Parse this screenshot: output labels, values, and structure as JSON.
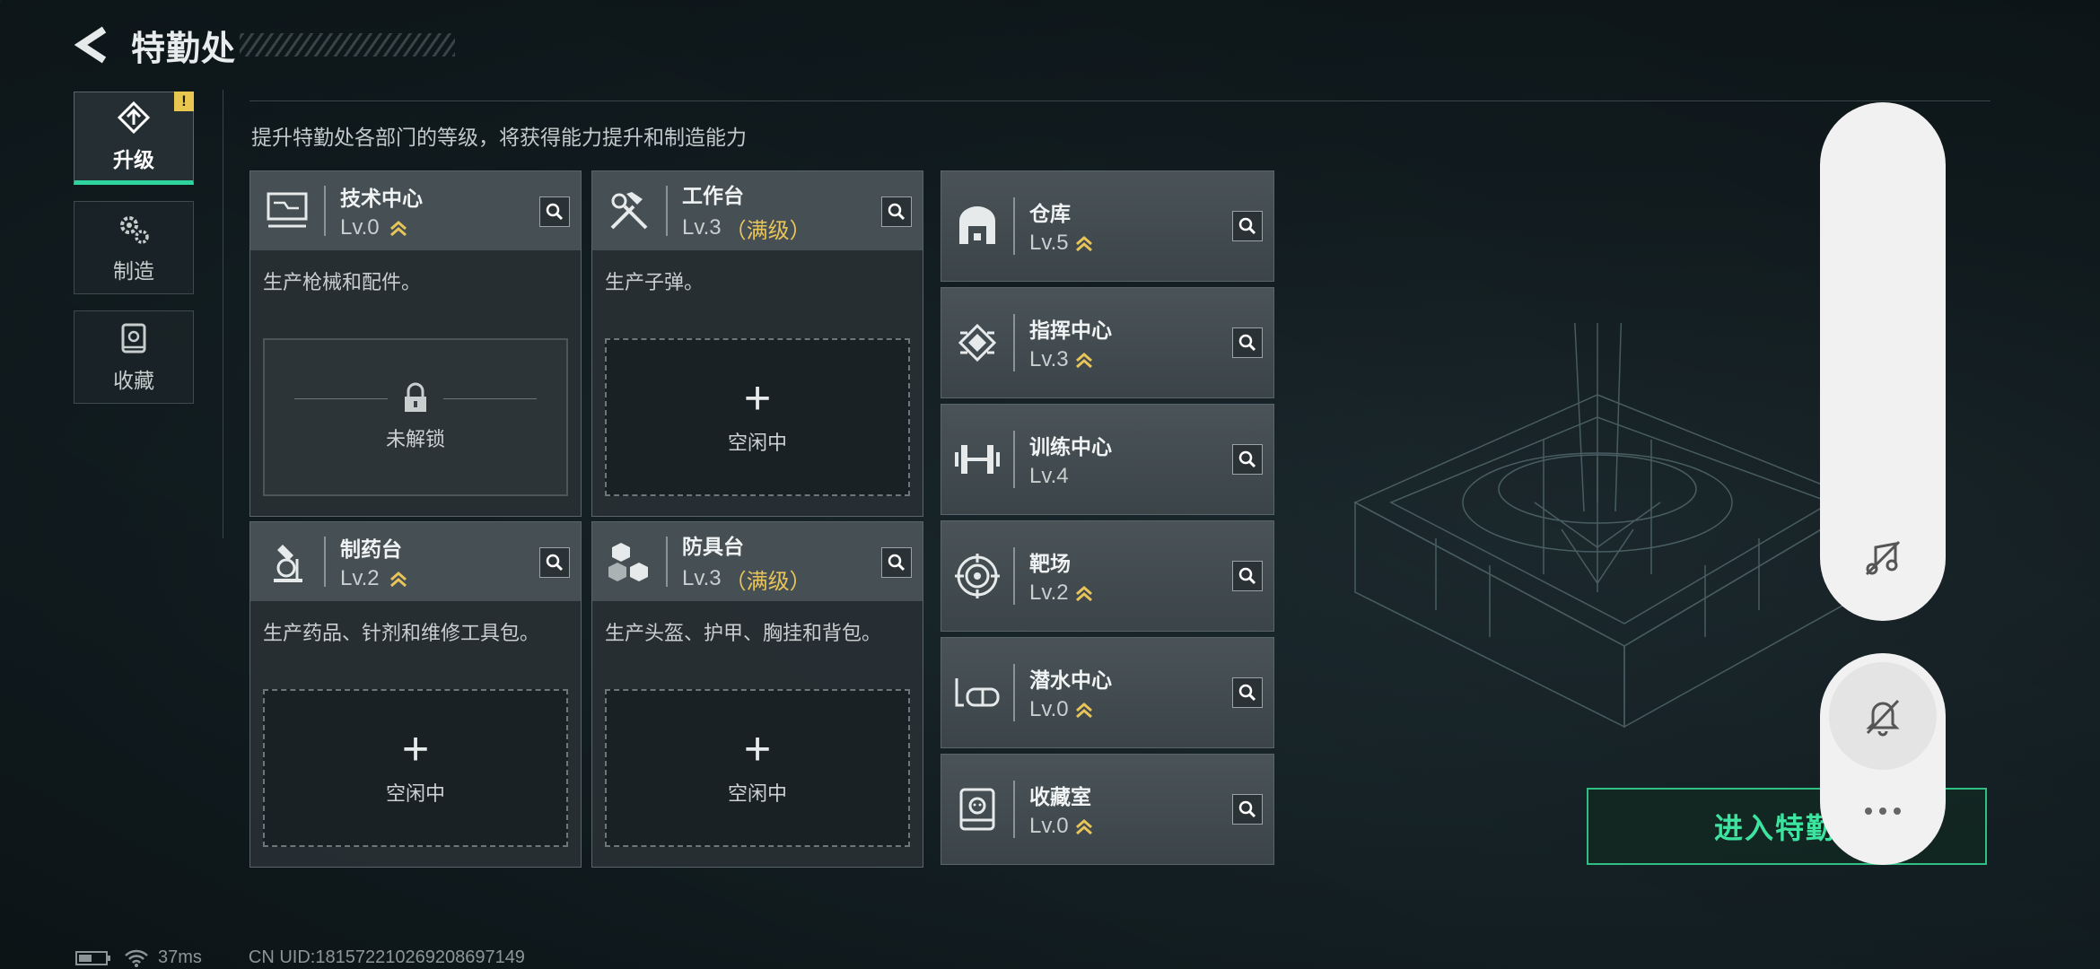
{
  "header": {
    "title": "特勤处"
  },
  "tabs": [
    {
      "label": "升级",
      "active": true,
      "badge": "!",
      "icon": "upgrade-icon"
    },
    {
      "label": "制造",
      "active": false,
      "icon": "gears-icon"
    },
    {
      "label": "收藏",
      "active": false,
      "icon": "collection-icon"
    }
  ],
  "subtitle": "提升特勤处各部门的等级，将获得能力提升和制造能力",
  "cards": [
    {
      "name": "技术中心",
      "level": "Lv.0",
      "max": "",
      "desc": "生产枪械和配件。",
      "slot": "未解锁",
      "locked": true,
      "icon": "monitor-icon"
    },
    {
      "name": "工作台",
      "level": "Lv.3",
      "max": "（满级）",
      "desc": "生产子弹。",
      "slot": "空闲中",
      "locked": false,
      "icon": "tools-icon"
    },
    {
      "name": "制药台",
      "level": "Lv.2",
      "max": "",
      "desc": "生产药品、针剂和维修工具包。",
      "slot": "空闲中",
      "locked": false,
      "icon": "microscope-icon"
    },
    {
      "name": "防具台",
      "level": "Lv.3",
      "max": "（满级）",
      "desc": "生产头盔、护甲、胸挂和背包。",
      "slot": "空闲中",
      "locked": false,
      "icon": "cubes-icon"
    }
  ],
  "facilities": [
    {
      "name": "仓库",
      "level": "Lv.5",
      "icon": "warehouse-icon"
    },
    {
      "name": "指挥中心",
      "level": "Lv.3",
      "icon": "chip-icon"
    },
    {
      "name": "训练中心",
      "level": "Lv.4",
      "icon": "dumbbell-icon"
    },
    {
      "name": "靶场",
      "level": "Lv.2",
      "icon": "target-icon"
    },
    {
      "name": "潜水中心",
      "level": "Lv.0",
      "icon": "diving-mask-icon"
    },
    {
      "name": "收藏室",
      "level": "Lv.0",
      "icon": "display-case-icon"
    }
  ],
  "enter_button": "进入特勤",
  "status": {
    "ping": "37ms",
    "uid": "CN UID:18157221026920869714​9"
  },
  "colors": {
    "accent": "#2fd39d",
    "max_level": "#e8c45a",
    "badge": "#e9c64f"
  }
}
